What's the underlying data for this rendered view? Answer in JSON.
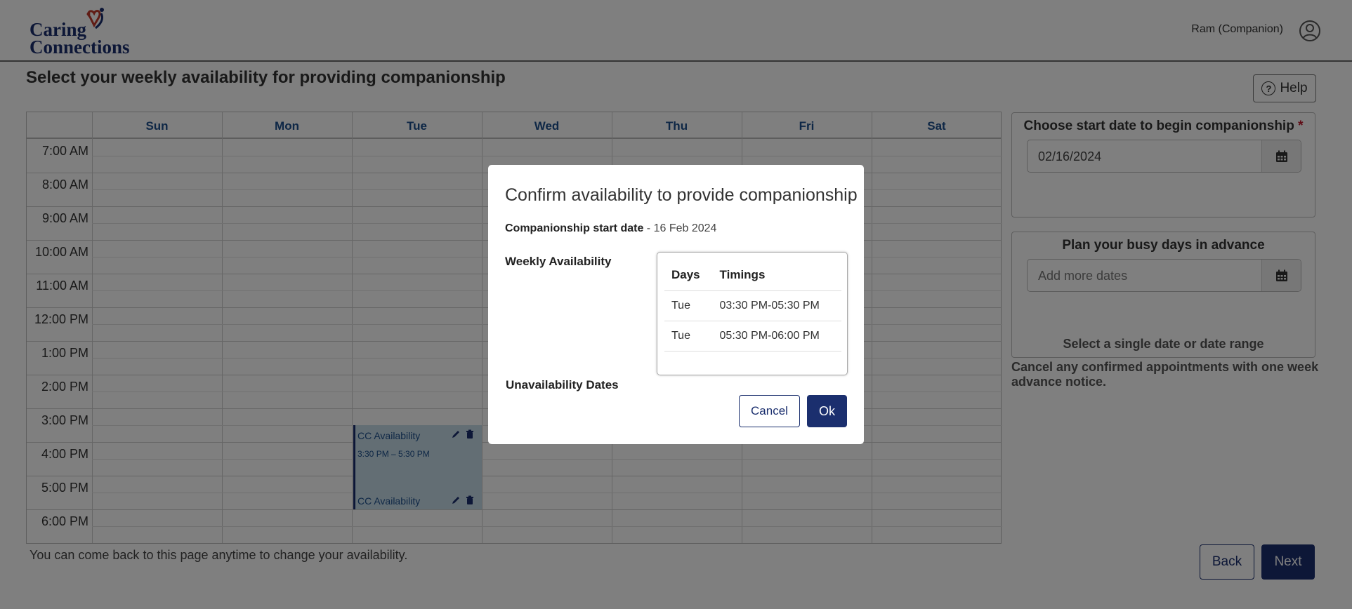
{
  "header": {
    "logo_line1": "Caring",
    "logo_line2": "Connections",
    "user_name": "Ram (Companion)"
  },
  "page": {
    "title": "Select your weekly availability for providing companionship",
    "help_label": "Help",
    "footer_note": "You can come back to this page anytime to change your availability."
  },
  "calendar": {
    "days": [
      "Sun",
      "Mon",
      "Tue",
      "Wed",
      "Thu",
      "Fri",
      "Sat"
    ],
    "times": [
      "7:00 AM",
      "8:00 AM",
      "9:00 AM",
      "10:00 AM",
      "11:00 AM",
      "12:00 PM",
      "1:00 PM",
      "2:00 PM",
      "3:00 PM",
      "4:00 PM",
      "5:00 PM",
      "6:00 PM"
    ],
    "events": [
      {
        "title": "CC Availability",
        "time": "3:30 PM – 5:30 PM"
      },
      {
        "title": "CC Availability",
        "time": ""
      }
    ]
  },
  "start_panel": {
    "title": "Choose start date to begin companionship",
    "required_mark": "*",
    "date_value": "02/16/2024"
  },
  "busy_panel": {
    "title": "Plan your busy days in advance",
    "placeholder": "Add more dates",
    "subtitle": "Select a single date or date range"
  },
  "cancel_note": "Cancel any confirmed appointments with one week advance notice.",
  "nav": {
    "back_label": "Back",
    "next_label": "Next"
  },
  "modal": {
    "title": "Confirm availability to provide companionship",
    "start_label": "Companionship start date",
    "start_value": " - 16 Feb 2024",
    "weekly_label": "Weekly Availability",
    "unavail_label": "Unavailability Dates",
    "table_headers": [
      "Days",
      "Timings"
    ],
    "rows": [
      {
        "day": "Tue",
        "timing": "03:30 PM-05:30 PM"
      },
      {
        "day": "Tue",
        "timing": "05:30 PM-06:00 PM"
      }
    ],
    "cancel_label": "Cancel",
    "ok_label": "Ok"
  },
  "colors": {
    "brand": "#1b2f6e",
    "day_header": "#1d4f8c",
    "event_bg": "#c7dce8",
    "required": "#c0192c"
  }
}
